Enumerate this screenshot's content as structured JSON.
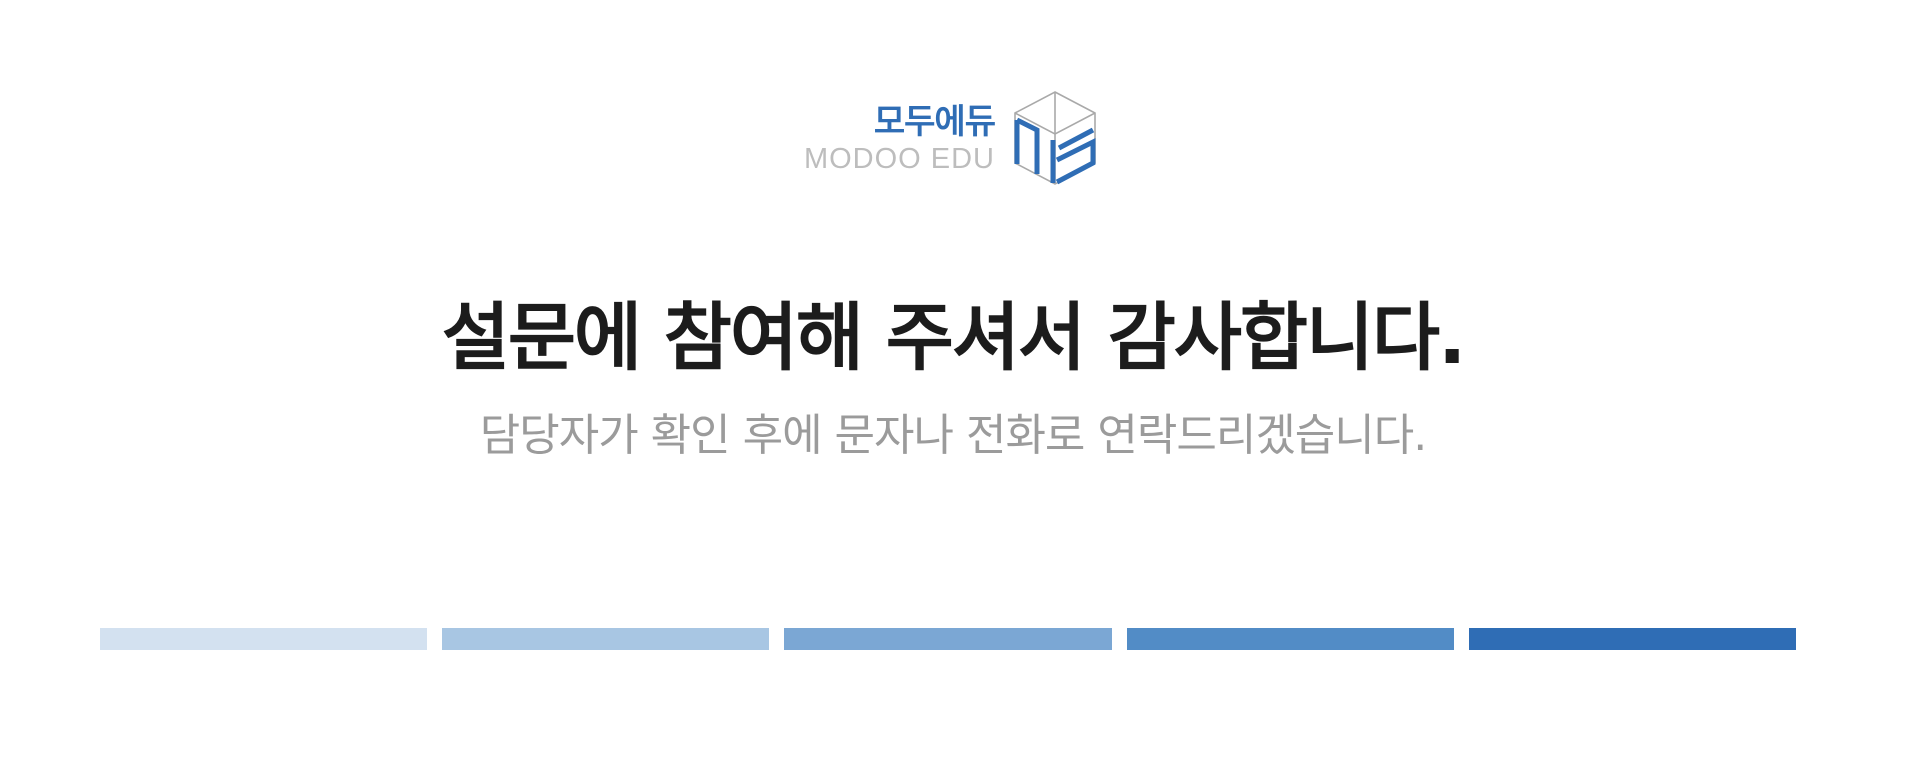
{
  "logo": {
    "name_ko": "모두에듀",
    "name_en": "MODOO EDU",
    "brand_color": "#2f6db5",
    "mark_icon": "cube-logo-icon"
  },
  "message": {
    "title": "설문에 참여해 주셔서 감사합니다.",
    "subtitle": "담당자가 확인 후에 문자나 전화로 연락드리겠습니다."
  },
  "progress": {
    "segments": [
      {
        "color": "#d3e1f0"
      },
      {
        "color": "#a8c6e3"
      },
      {
        "color": "#7ba7d4"
      },
      {
        "color": "#528cc6"
      },
      {
        "color": "#2f6db5"
      }
    ]
  }
}
